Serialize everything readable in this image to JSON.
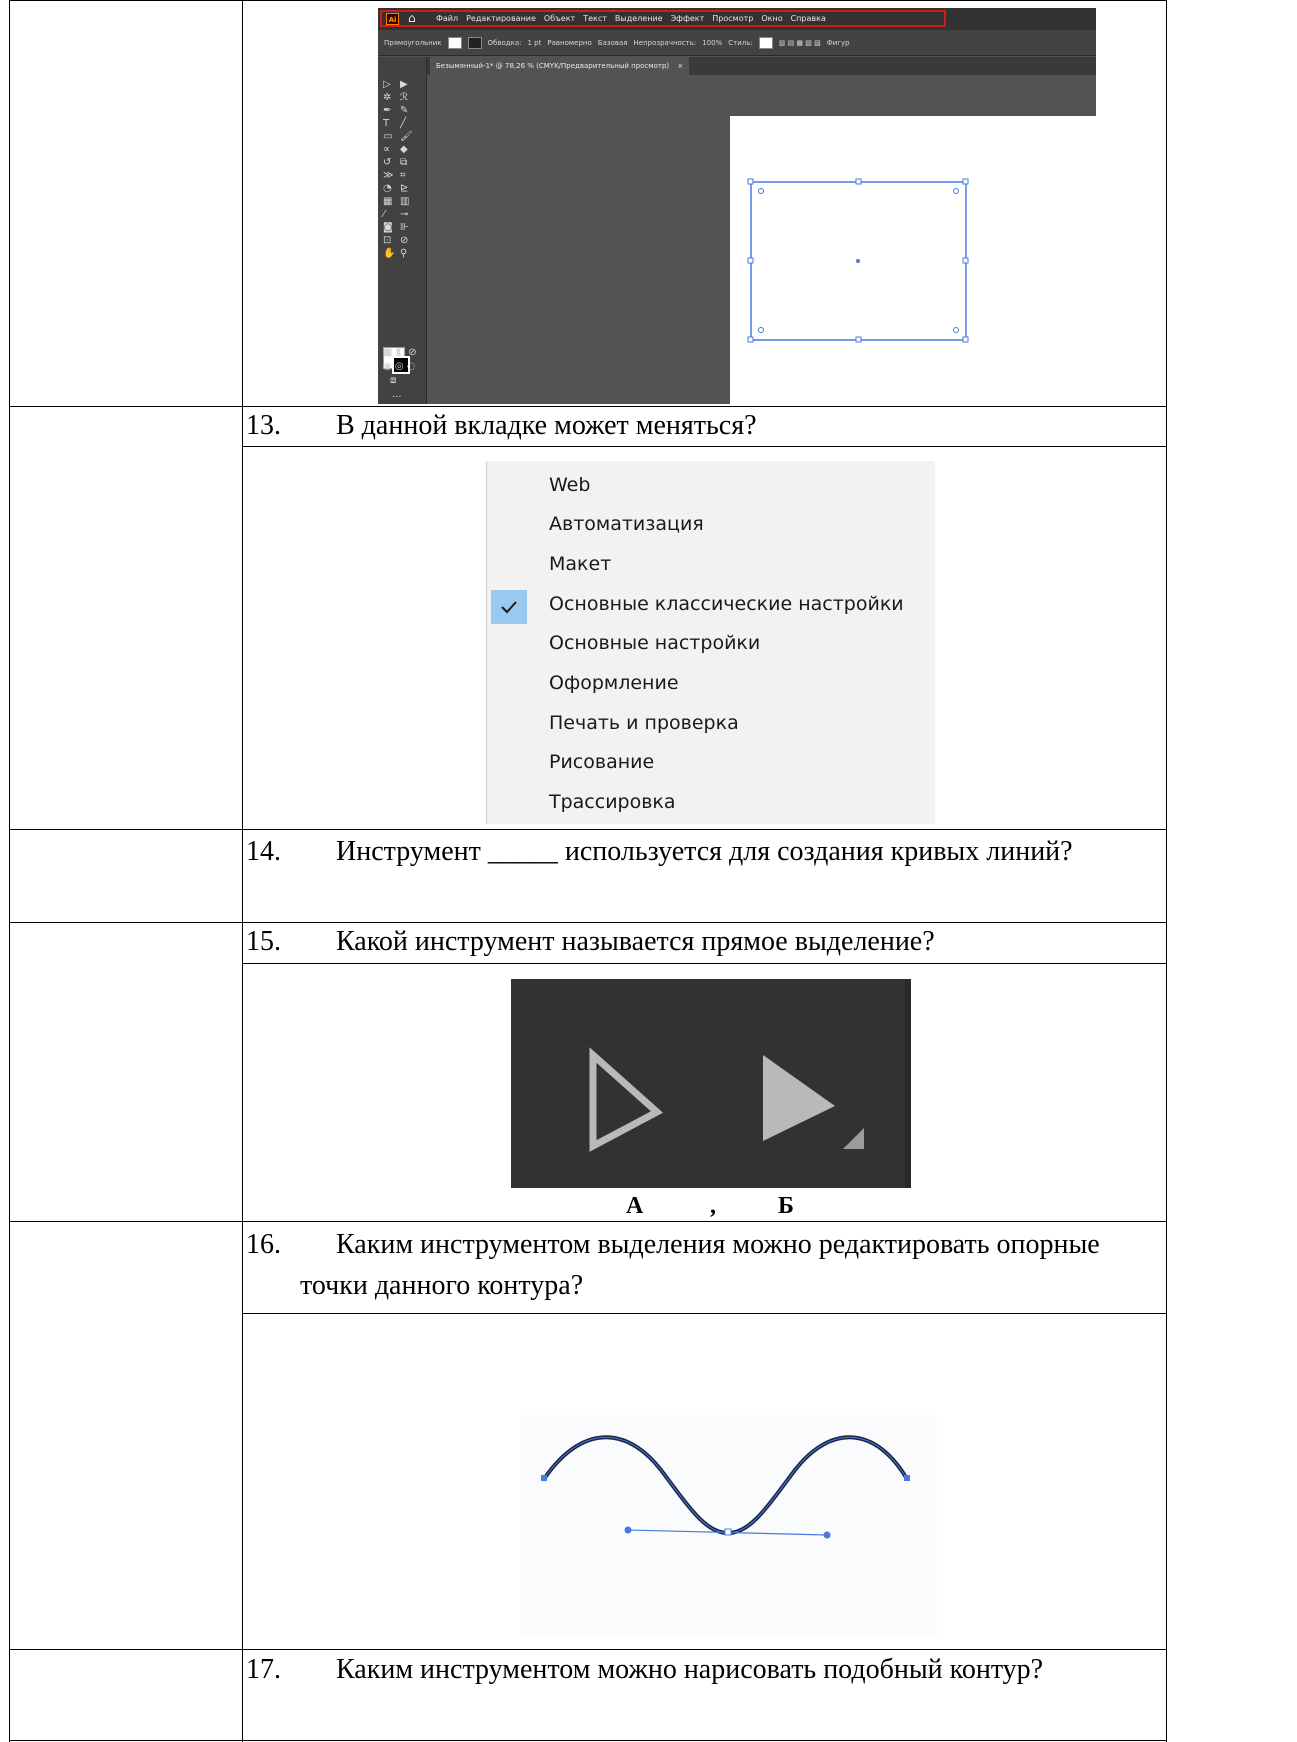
{
  "illustrator": {
    "logo": "Ai",
    "menu": [
      "Файл",
      "Редактирование",
      "Объект",
      "Текст",
      "Выделение",
      "Эффект",
      "Просмотр",
      "Окно",
      "Справка"
    ],
    "control_bar": {
      "object": "Прямоугольник",
      "stroke_label": "Обводка:",
      "stroke_value": "1 pt",
      "profile": "Равномерно",
      "brush": "Базовая",
      "opacity_label": "Непрозрачность:",
      "opacity_value": "100%",
      "style_label": "Стиль:",
      "shape_label": "Фигур"
    },
    "tab_title": "Безымянный-1* @ 78,26 % (CMYK/Предварительный просмотр)",
    "tab_close": "×",
    "more_tools": "...",
    "colors": {
      "ui_dark": "#323232",
      "canvas": "#535353",
      "highlight": "#d01c1c",
      "selection": "#4a78e0"
    }
  },
  "questions": {
    "q13": {
      "number": "13.",
      "text": "В данной вкладке может меняться?"
    },
    "q14": {
      "number": "14.",
      "text": "Инструмент _____ используется для создания кривых линий?"
    },
    "q15": {
      "number": "15.",
      "text": "Какой инструмент называется прямое выделение?"
    },
    "q16": {
      "number": "16.",
      "line1": "Каким инструментом выделения можно редактировать опорные",
      "line2": "точки данного контура?"
    },
    "q17": {
      "number": "17.",
      "text": "Каким инструментом можно нарисовать подобный контур?"
    }
  },
  "workspace_menu": {
    "items": [
      "Web",
      "Автоматизация",
      "Макет",
      "Основные классические настройки",
      "Основные настройки",
      "Оформление",
      "Печать и проверка",
      "Рисование",
      "Трассировка"
    ],
    "checked_item": "Основные классические настройки",
    "checkmark": "✓"
  },
  "selection_tools": {
    "label_a": "А",
    "comma": ",",
    "label_b": "Б"
  }
}
